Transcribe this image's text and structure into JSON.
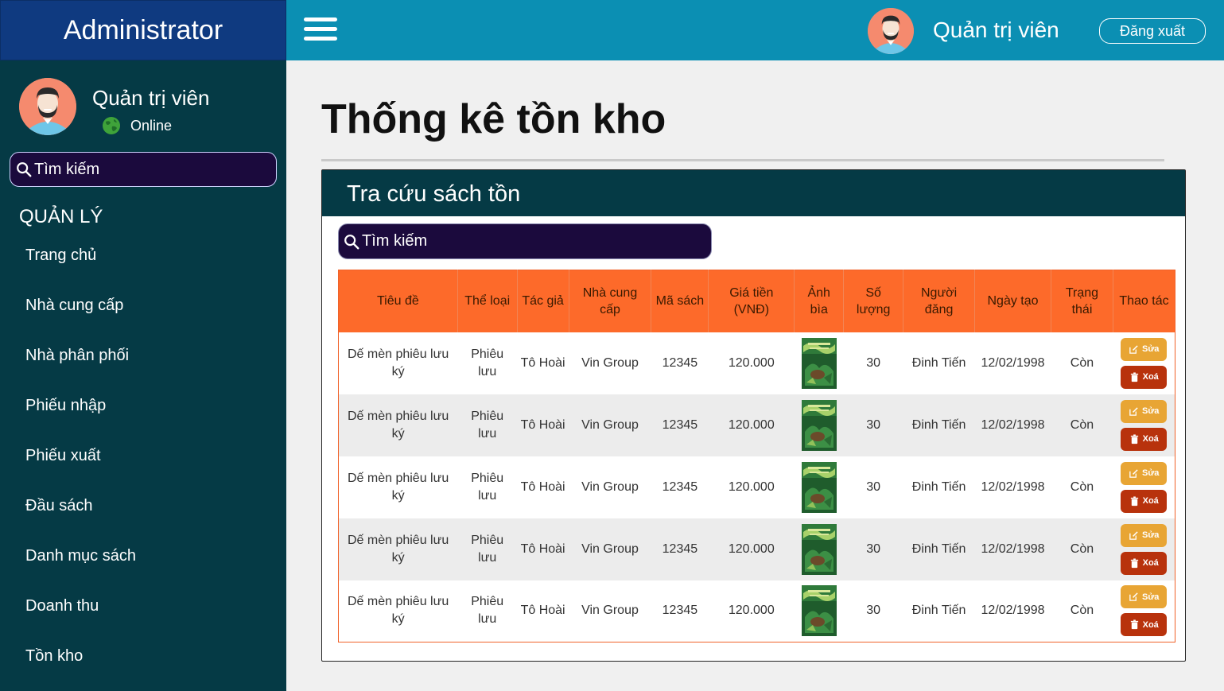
{
  "brand": {
    "title": "Administrator"
  },
  "user": {
    "name": "Quản trị viên",
    "status": "Online"
  },
  "topbar": {
    "user_name": "Quản trị viên",
    "logout_label": "Đăng xuất"
  },
  "sidebar": {
    "search_placeholder": "Tìm kiếm",
    "section_title": "QUẢN LÝ",
    "items": [
      {
        "label": "Trang chủ"
      },
      {
        "label": "Nhà cung cấp"
      },
      {
        "label": "Nhà phân phối"
      },
      {
        "label": "Phiếu nhập"
      },
      {
        "label": "Phiếu xuất"
      },
      {
        "label": "Đầu sách"
      },
      {
        "label": "Danh mục sách"
      },
      {
        "label": "Doanh thu"
      },
      {
        "label": "Tồn kho"
      }
    ]
  },
  "main": {
    "page_title": "Thống kê tồn kho",
    "panel_title": "Tra cứu sách tồn",
    "search_placeholder": "Tìm kiếm",
    "columns": [
      "Tiêu đề",
      "Thể loại",
      "Tác giả",
      "Nhà cung cấp",
      "Mã sách",
      "Giá tiền (VNĐ)",
      "Ảnh bìa",
      "Số lượng",
      "Người đăng",
      "Ngày tạo",
      "Trạng thái",
      "Thao tác"
    ],
    "rows": [
      {
        "title": "Dế mèn phiêu lưu ký",
        "genre": "Phiêu lưu",
        "author": "Tô Hoài",
        "supplier": "Vin Group",
        "code": "12345",
        "price": "120.000",
        "qty": "30",
        "poster": "Đinh Tiến",
        "date": "12/02/1998",
        "status": "Còn"
      },
      {
        "title": "Dế mèn phiêu lưu ký",
        "genre": "Phiêu lưu",
        "author": "Tô Hoài",
        "supplier": "Vin Group",
        "code": "12345",
        "price": "120.000",
        "qty": "30",
        "poster": "Đinh Tiến",
        "date": "12/02/1998",
        "status": "Còn"
      },
      {
        "title": "Dế mèn phiêu lưu ký",
        "genre": "Phiêu lưu",
        "author": "Tô Hoài",
        "supplier": "Vin Group",
        "code": "12345",
        "price": "120.000",
        "qty": "30",
        "poster": "Đinh Tiến",
        "date": "12/02/1998",
        "status": "Còn"
      },
      {
        "title": "Dế mèn phiêu lưu ký",
        "genre": "Phiêu lưu",
        "author": "Tô Hoài",
        "supplier": "Vin Group",
        "code": "12345",
        "price": "120.000",
        "qty": "30",
        "poster": "Đinh Tiến",
        "date": "12/02/1998",
        "status": "Còn"
      },
      {
        "title": "Dế mèn phiêu lưu ký",
        "genre": "Phiêu lưu",
        "author": "Tô Hoài",
        "supplier": "Vin Group",
        "code": "12345",
        "price": "120.000",
        "qty": "30",
        "poster": "Đinh Tiến",
        "date": "12/02/1998",
        "status": "Còn"
      }
    ],
    "edit_label": "Sửa",
    "delete_label": "Xoá"
  },
  "icons": {
    "menu": "hamburger-icon",
    "search": "search-icon",
    "status": "globe-icon",
    "avatar": "avatar-icon",
    "edit": "edit-icon",
    "delete": "trash-icon",
    "cover": "book-cover-image"
  },
  "colors": {
    "brand_bg": "#0f3a80",
    "sidebar_bg": "#053a45",
    "topbar_bg": "#0b8fb3",
    "table_header": "#fd6a2a",
    "edit_button": "#e8a534",
    "delete_button": "#b8320c",
    "search_bg": "#1b0a3d"
  }
}
